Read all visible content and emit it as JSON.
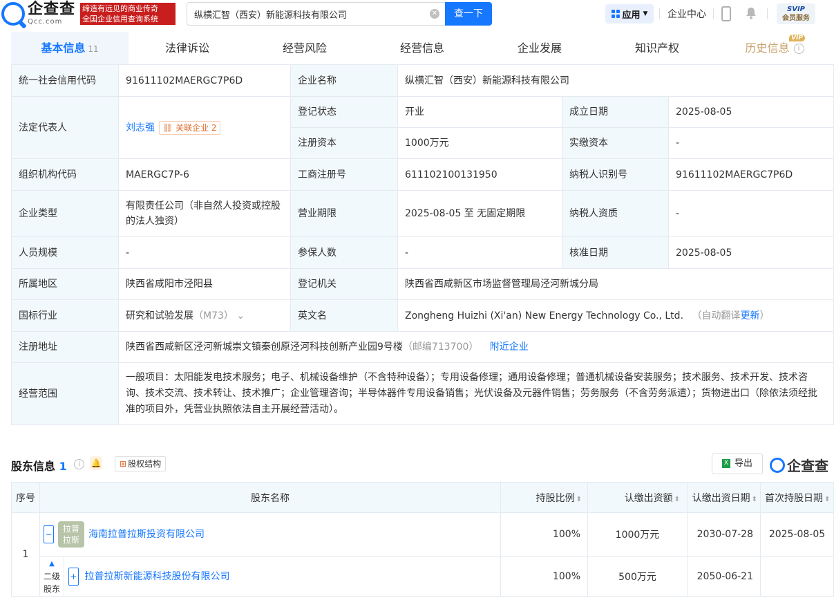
{
  "header": {
    "logo_cn": "企查查",
    "logo_en": "Qcc.com",
    "slogan_line1": "缔造有远见的商业传奇",
    "slogan_line2": "全国企业信用查询系统",
    "search_value": "纵横汇智（西安）新能源科技有限公司",
    "search_button": "查一下",
    "app_button": "应用",
    "enterprise_center": "企业中心",
    "svip_top": "SVIP",
    "svip_bottom": "会员服务"
  },
  "tabs": [
    {
      "label": "基本信息",
      "count": "11"
    },
    {
      "label": "法律诉讼"
    },
    {
      "label": "经营风险"
    },
    {
      "label": "经营信息"
    },
    {
      "label": "企业发展"
    },
    {
      "label": "知识产权"
    },
    {
      "label": "历史信息",
      "badge": "VIP"
    }
  ],
  "info": {
    "credit_code_label": "统一社会信用代码",
    "credit_code": "91611102MAERGC7P6D",
    "name_label": "企业名称",
    "name": "纵横汇智（西安）新能源科技有限公司",
    "legal_rep_label": "法定代表人",
    "legal_rep": "刘志强",
    "related_label": "关联企业",
    "related_count": "2",
    "status_label": "登记状态",
    "status": "开业",
    "founded_label": "成立日期",
    "founded": "2025-08-05",
    "reg_capital_label": "注册资本",
    "reg_capital": "1000万元",
    "paid_capital_label": "实缴资本",
    "paid_capital": "-",
    "org_code_label": "组织机构代码",
    "org_code": "MAERGC7P-6",
    "biz_reg_no_label": "工商注册号",
    "biz_reg_no": "611102100131950",
    "taxpayer_id_label": "纳税人识别号",
    "taxpayer_id": "91611102MAERGC7P6D",
    "type_label": "企业类型",
    "type": "有限责任公司（非自然人投资或控股的法人独资）",
    "term_label": "营业期限",
    "term": "2025-08-05 至 无固定期限",
    "taxpayer_qual_label": "纳税人资质",
    "taxpayer_qual": "-",
    "staff_label": "人员规模",
    "staff": "-",
    "insured_label": "参保人数",
    "insured": "-",
    "approved_label": "核准日期",
    "approved": "2025-08-05",
    "region_label": "所属地区",
    "region": "陕西省咸阳市泾阳县",
    "authority_label": "登记机关",
    "authority": "陕西省西咸新区市场监督管理局泾河新城分局",
    "industry_label": "国标行业",
    "industry": "研究和试验发展",
    "industry_code": "（M73）",
    "en_name_label": "英文名",
    "en_name": "Zongheng Huizhi (Xi'an) New Energy Technology Co., Ltd.",
    "auto_translate": "（自动翻译",
    "update_link": "更新",
    "auto_translate_end": "）",
    "address_label": "注册地址",
    "address": "陕西省西咸新区泾河新城崇文镇秦创原泾河科技创新产业园9号楼",
    "postcode": "（邮编713700）",
    "nearby": "附近企业",
    "scope_label": "经营范围",
    "scope": "一般项目：太阳能发电技术服务；电子、机械设备维护（不含特种设备）；专用设备修理；通用设备修理；普通机械设备安装服务；技术服务、技术开发、技术咨询、技术交流、技术转让、技术推广；企业管理咨询；半导体器件专用设备销售；光伏设备及元器件销售；劳务服务（不含劳务派遣）；货物进出口（除依法须经批准的项目外，凭营业执照依法自主开展经营活动）。"
  },
  "shareholders": {
    "title": "股东信息",
    "count": "1",
    "structure_label": "股权结构",
    "export_label": "导出",
    "qcc_label": "企查查",
    "headers": [
      "序号",
      "股东名称",
      "持股比例",
      "认缴出资额",
      "认缴出资日期",
      "首次持股日期"
    ],
    "rows": [
      {
        "index": "1",
        "avatar_line1": "拉普",
        "avatar_line2": "拉斯",
        "name": "海南拉普拉斯投资有限公司",
        "ratio": "100%",
        "amount": "1000万元",
        "subscribe_date": "2030-07-28",
        "first_date": "2025-08-05",
        "level_line1": "二级",
        "level_line2": "股东",
        "sub_name": "拉普拉斯新能源科技股份有限公司",
        "sub_ratio": "100%",
        "sub_amount": "500万元",
        "sub_subscribe_date": "2050-06-21",
        "sub_first_date": ""
      }
    ]
  }
}
